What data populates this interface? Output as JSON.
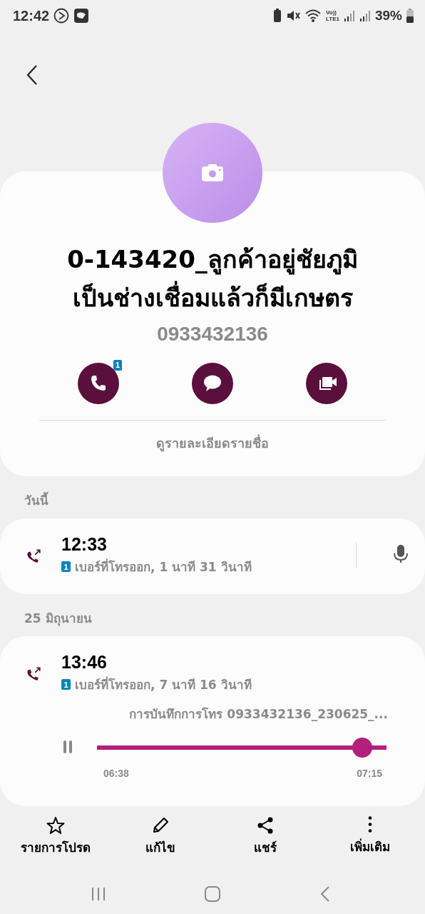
{
  "status_bar": {
    "time": "12:42",
    "vo_label": "Vo))",
    "lte_label": "LTE1",
    "battery_text": "39%"
  },
  "contact": {
    "name_lines": [
      "0-143420_ลูกค้าอยู่ชัยภูมิ",
      "เป็นช่างเชื่อมแล้วก็มีเกษตร"
    ],
    "phone": "0933432136",
    "actions": [
      {
        "kind": "call",
        "badge": "1"
      },
      {
        "kind": "message"
      },
      {
        "kind": "video"
      }
    ],
    "details_link": "ดูรายละเอียดรายชื่อ"
  },
  "call_groups": [
    {
      "date": "วันนี้",
      "calls": [
        {
          "time": "12:33",
          "sim": "1",
          "detail": "เบอร์ที่โทรออก, 1 นาที 31 วินาที",
          "has_recording_button": true
        }
      ]
    },
    {
      "date": "25 มิถุนายน",
      "calls": [
        {
          "time": "13:46",
          "sim": "1",
          "detail": "เบอร์ที่โทรออก, 7 นาที 16 วินาที",
          "has_recording_button": false,
          "recording": {
            "title": "การบันทึกการโทร 0933432136_230625_...",
            "playing": true,
            "level": 0.917,
            "elapsed": "06:38",
            "total": "07:15"
          }
        }
      ]
    }
  ],
  "bottom_actions": [
    {
      "kind": "favorite",
      "label": "รายการโปรด"
    },
    {
      "kind": "edit",
      "label": "แก้ไข"
    },
    {
      "kind": "share",
      "label": "แชร์"
    },
    {
      "kind": "more",
      "label": "เพิ่มเติม"
    }
  ]
}
